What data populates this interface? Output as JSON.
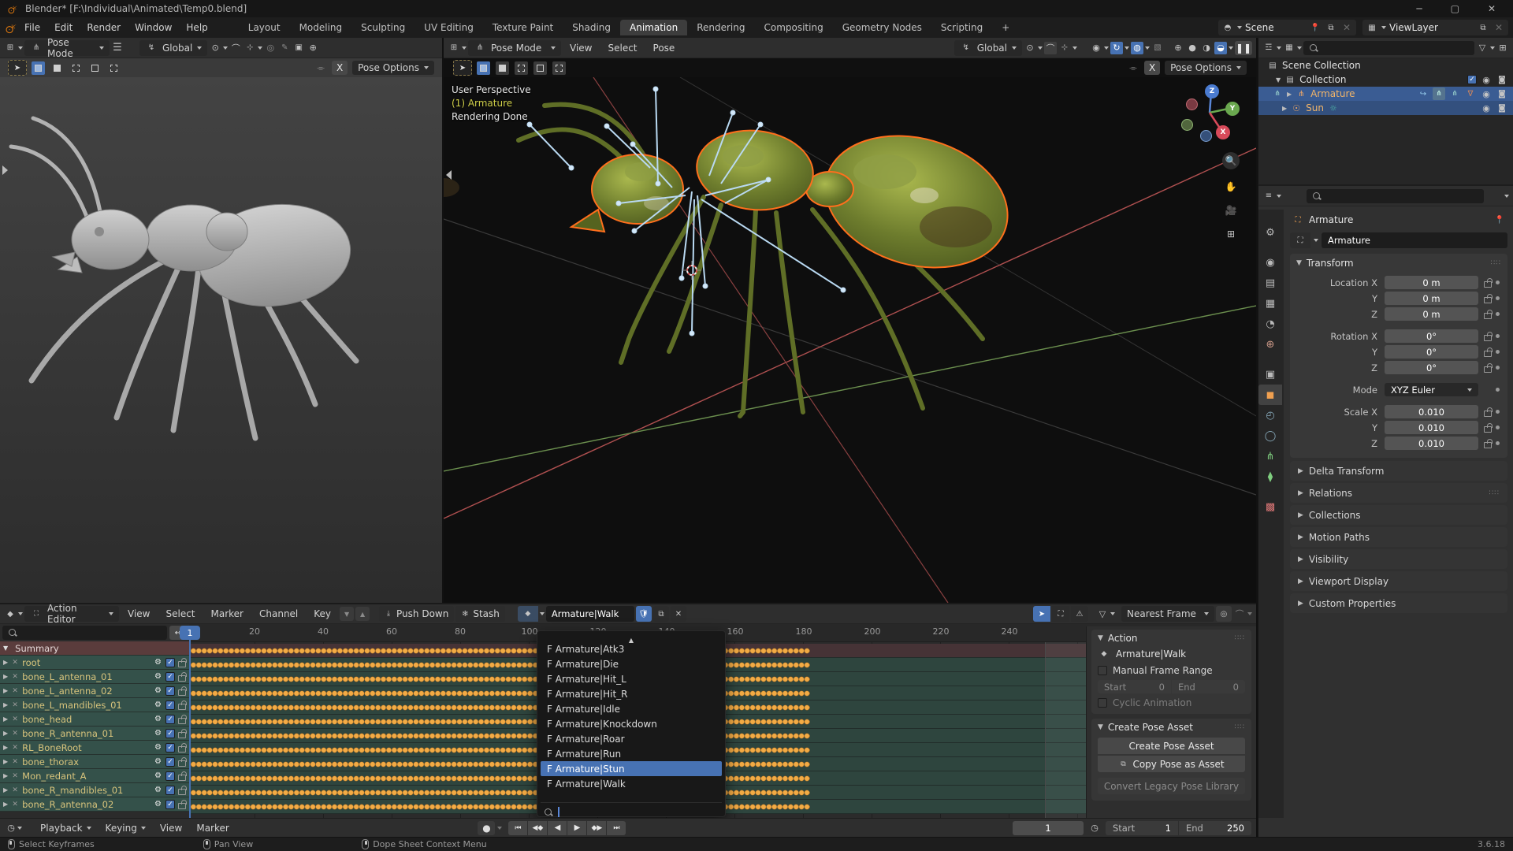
{
  "window": {
    "title": "Blender* [F:\\Individual\\Animated\\Temp0.blend]",
    "minimize": "─",
    "maximize": "▢",
    "close": "✕"
  },
  "topbar": {
    "menus": [
      "File",
      "Edit",
      "Render",
      "Window",
      "Help"
    ],
    "workspaces": [
      "Layout",
      "Modeling",
      "Sculpting",
      "UV Editing",
      "Texture Paint",
      "Shading",
      "Animation",
      "Rendering",
      "Compositing",
      "Geometry Nodes",
      "Scripting"
    ],
    "active_workspace": "Animation",
    "add_workspace": "+",
    "scene": "Scene",
    "view_layer": "ViewLayer"
  },
  "viewport_left": {
    "mode": "Pose Mode",
    "orientation": "Global",
    "pose_options": "Pose Options",
    "mirror_x": "X"
  },
  "viewport_right": {
    "mode": "Pose Mode",
    "menus": [
      "View",
      "Select",
      "Pose"
    ],
    "orientation": "Global",
    "pose_options": "Pose Options",
    "mirror_x": "X",
    "overlay": [
      "User Perspective",
      "(1) Armature",
      "Rendering Done"
    ],
    "gizmo_axes": [
      "Z",
      "Y",
      "X"
    ]
  },
  "outliner": {
    "rows": [
      {
        "label": "Scene Collection"
      },
      {
        "label": "Collection"
      },
      {
        "label": "Armature",
        "selected": true
      },
      {
        "label": "Sun",
        "selected": true
      }
    ]
  },
  "properties": {
    "breadcrumb": "Armature",
    "name_field": "Armature",
    "transform_title": "Transform",
    "rows": [
      {
        "label": "Location X",
        "value": "0 m"
      },
      {
        "label": "Y",
        "value": "0 m"
      },
      {
        "label": "Z",
        "value": "0 m"
      },
      {
        "label": "Rotation X",
        "value": "0°"
      },
      {
        "label": "Y",
        "value": "0°"
      },
      {
        "label": "Z",
        "value": "0°"
      }
    ],
    "mode_label": "Mode",
    "mode_value": "XYZ Euler",
    "scale_rows": [
      {
        "label": "Scale X",
        "value": "0.010"
      },
      {
        "label": "Y",
        "value": "0.010"
      },
      {
        "label": "Z",
        "value": "0.010"
      }
    ],
    "sections": [
      "Delta Transform",
      "Relations",
      "Collections",
      "Motion Paths",
      "Visibility",
      "Viewport Display",
      "Custom Properties"
    ]
  },
  "dopesheet": {
    "editor_type": "Action Editor",
    "menus": [
      "View",
      "Select",
      "Marker",
      "Channel",
      "Key"
    ],
    "push_down": "Push Down",
    "stash": "Stash",
    "action_name": "Armature|Walk",
    "snap_mode": "Nearest Frame",
    "current_frame": "1",
    "summary_label": "Summary",
    "channels": [
      "root",
      "bone_L_antenna_01",
      "bone_L_antenna_02",
      "bone_L_mandibles_01",
      "bone_head",
      "bone_R_antenna_01",
      "RL_BoneRoot",
      "bone_thorax",
      "Mon_redant_A",
      "bone_R_mandibles_01",
      "bone_R_antenna_02"
    ],
    "ruler_frames": [
      "20",
      "40",
      "60",
      "80",
      "100",
      "120",
      "140",
      "160",
      "180",
      "200",
      "220",
      "240"
    ],
    "keys_end_frame": 181,
    "range_end_frame": 250
  },
  "action_dropdown": {
    "items": [
      "F Armature|Atk3",
      "F Armature|Die",
      "F Armature|Hit_L",
      "F Armature|Hit_R",
      "F Armature|Idle",
      "F Armature|Knockdown",
      "F Armature|Roar",
      "F Armature|Run",
      "F Armature|Stun",
      "F Armature|Walk"
    ],
    "selected": "F Armature|Stun",
    "selected_index": 8
  },
  "action_sidebar": {
    "panel_title": "Action",
    "action_name": "Armature|Walk",
    "manual_frame_range": "Manual Frame Range",
    "start_label": "Start",
    "start_value": "0",
    "end_label": "End",
    "end_value": "0",
    "cyclic": "Cyclic Animation",
    "create_title": "Create Pose Asset",
    "buttons": [
      "Create Pose Asset",
      "Copy Pose as Asset",
      "Convert Legacy Pose Library"
    ]
  },
  "playback": {
    "menus": [
      "Playback",
      "Keying",
      "View",
      "Marker"
    ],
    "frame": "1",
    "start_label": "Start",
    "start_value": "1",
    "end_label": "End",
    "end_value": "250"
  },
  "statusbar": {
    "hints": [
      "Select Keyframes",
      "Pan View",
      "Dope Sheet Context Menu"
    ],
    "version": "3.6.18"
  },
  "colors": {
    "accent": "#4772b3",
    "keyframe": "#f2ab45",
    "selected_channel": "#34514a",
    "summary_row": "#5a3c3c",
    "object_orange": "#f0b46a"
  }
}
